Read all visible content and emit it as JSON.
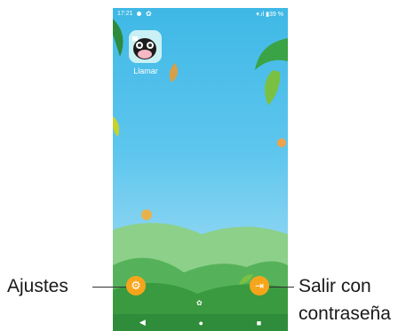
{
  "status_bar": {
    "time": "17:21",
    "right": "▾.ıl ▮39 %"
  },
  "app": {
    "label": "Llamar",
    "icon": "cow-icon"
  },
  "callouts": {
    "left": "Ajustes",
    "right_line1": "Salir con",
    "right_line2": "contraseña"
  },
  "buttons": {
    "settings_icon": "gear-icon",
    "exit_icon": "exit-icon"
  },
  "nav": {
    "back": "◀",
    "home": "●",
    "recents": "■",
    "center_paw": "🐾"
  },
  "colors": {
    "sky": "#5ec6ee",
    "accent": "#f6a51b",
    "hills": "#2f8c3a"
  }
}
